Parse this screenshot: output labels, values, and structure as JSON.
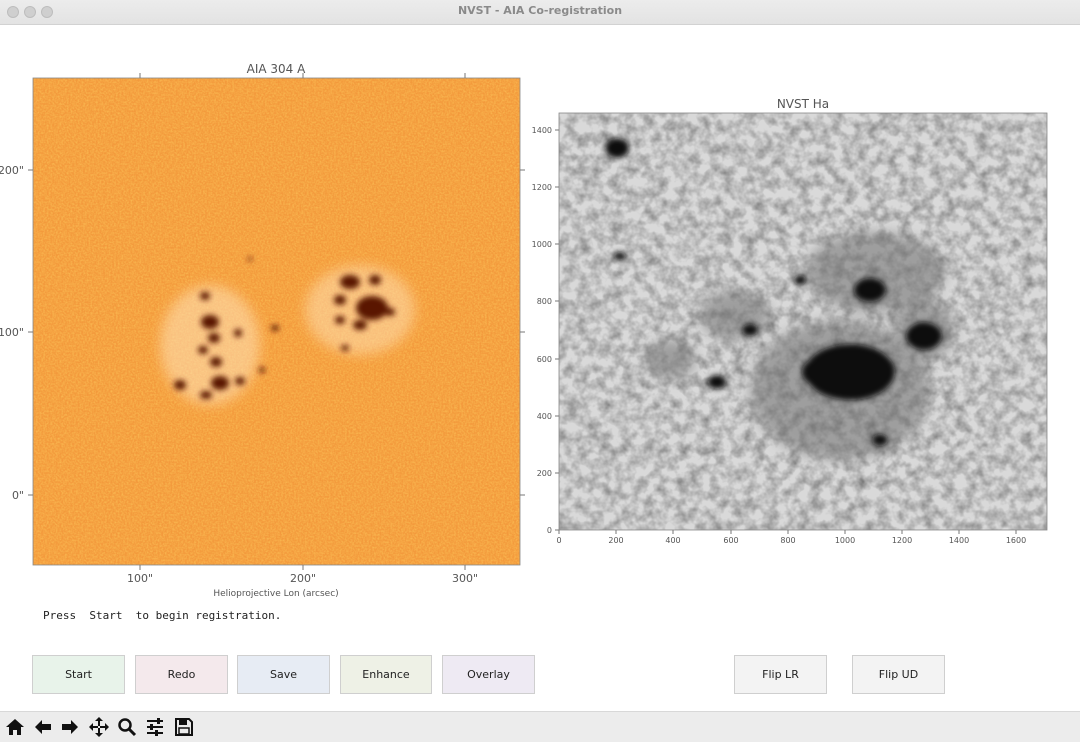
{
  "window": {
    "title": "NVST - AIA Co-registration"
  },
  "left_plot": {
    "title": "AIA 304 A",
    "xlabel": "Helioprojective Lon (arcsec)",
    "xticks": [
      "100\"",
      "200\"",
      "300\""
    ],
    "yticks": [
      "200\"",
      "100\"",
      "0\""
    ],
    "colormap": "orange/sdo-304"
  },
  "right_plot": {
    "title": "NVST Ha",
    "xticks": [
      "0",
      "200",
      "400",
      "600",
      "800",
      "1000",
      "1200",
      "1400",
      "1600"
    ],
    "yticks": [
      "1400",
      "1200",
      "1000",
      "800",
      "600",
      "400",
      "200",
      "0"
    ],
    "colormap": "gray"
  },
  "status": {
    "message": "Press  Start  to begin registration."
  },
  "buttons": {
    "start": "Start",
    "redo": "Redo",
    "save": "Save",
    "enhance": "Enhance",
    "overlay": "Overlay",
    "flip_lr": "Flip LR",
    "flip_ud": "Flip UD"
  },
  "colors": {
    "start_bg": "#e8f3ea",
    "redo_bg": "#f4e9ec",
    "save_bg": "#e7ecf4",
    "enhance_bg": "#eef1e6",
    "overlay_bg": "#eeeaf3",
    "flip_bg": "#f3f3f3"
  },
  "toolbar": {
    "icons": [
      "home-icon",
      "back-arrow-icon",
      "forward-arrow-icon",
      "pan-icon",
      "zoom-icon",
      "configure-icon",
      "save-icon"
    ]
  }
}
